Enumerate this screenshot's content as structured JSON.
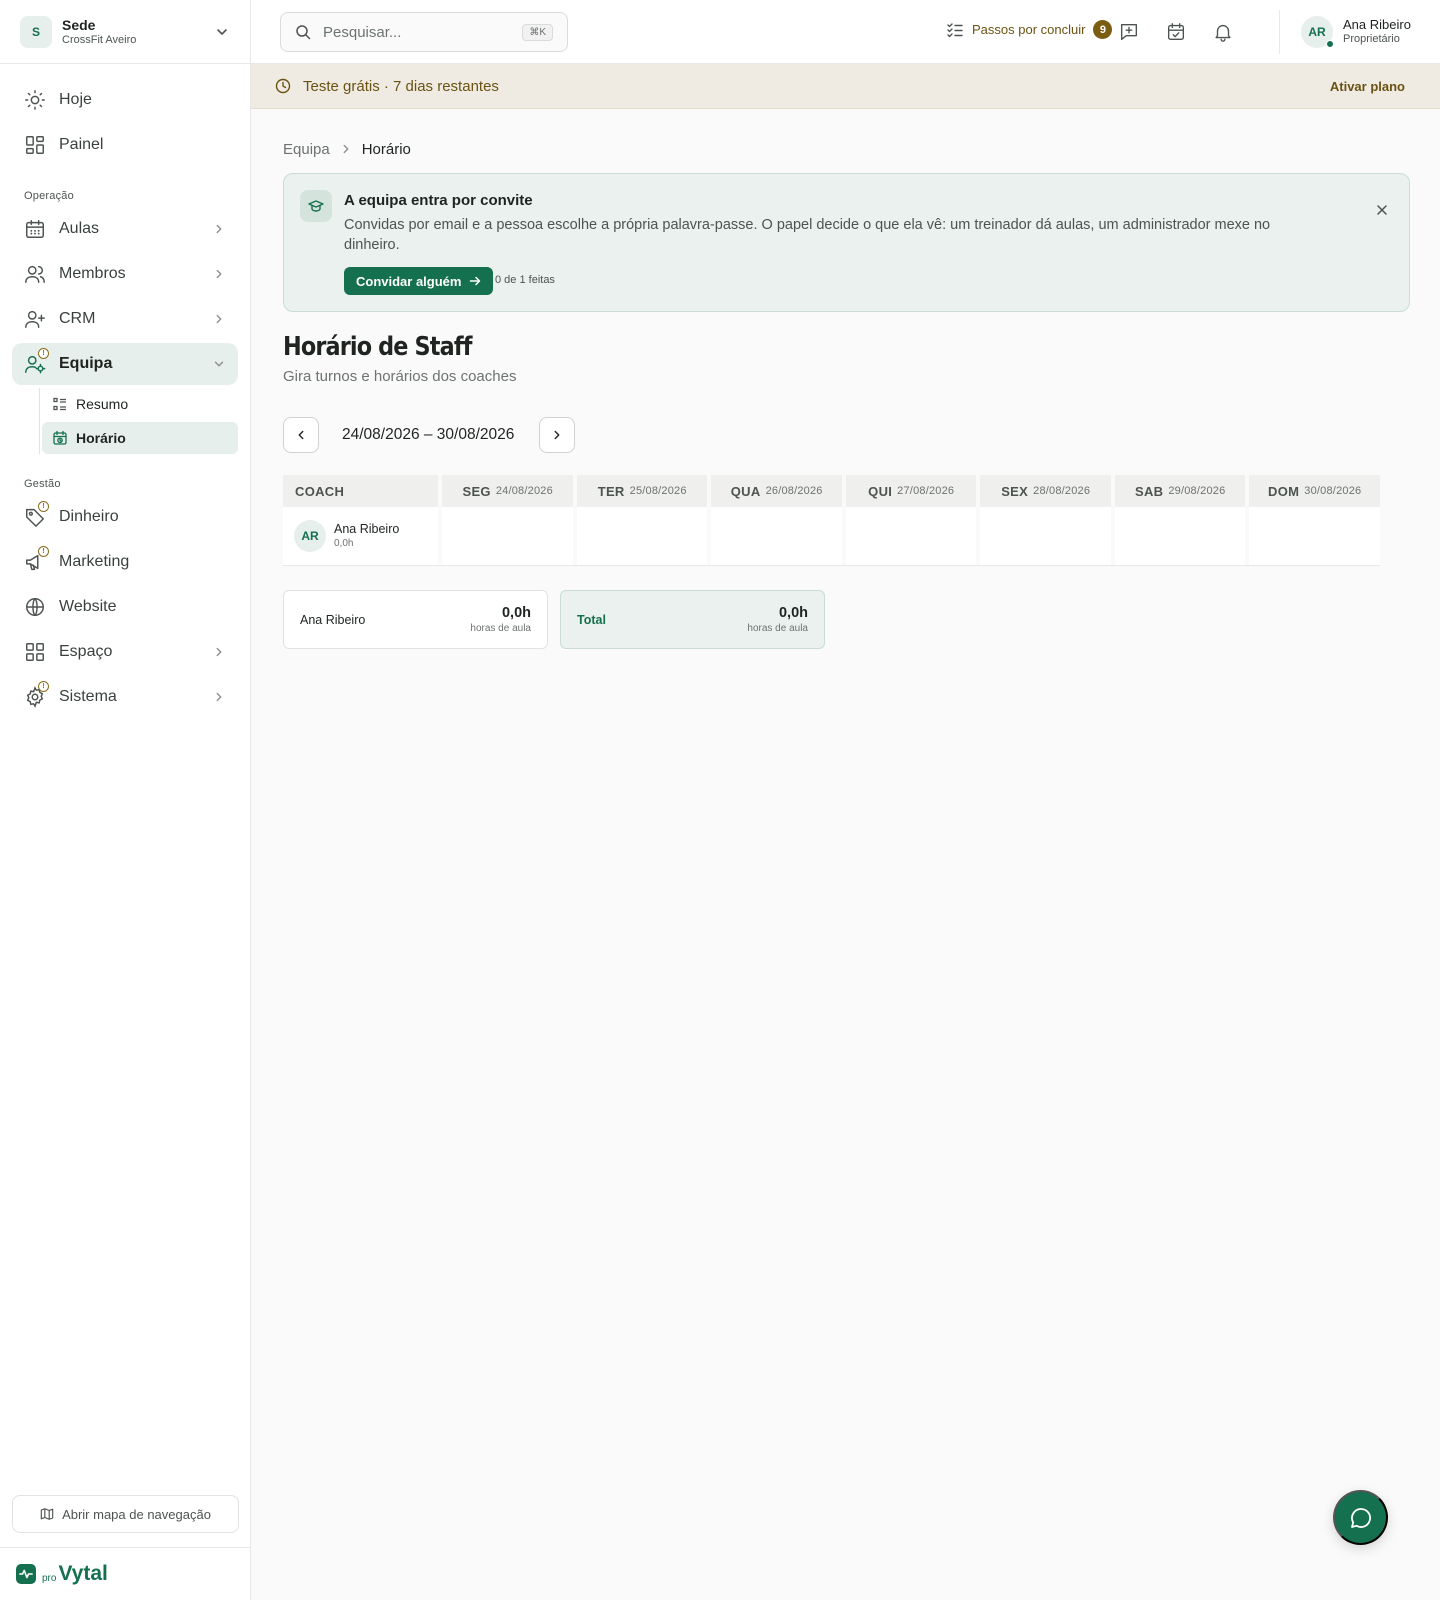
{
  "org": {
    "avatar": "S",
    "name": "Sede",
    "sub": "CrossFit Aveiro"
  },
  "nav": {
    "hoje": "Hoje",
    "painel": "Painel",
    "section_operacao": "Operação",
    "aulas": "Aulas",
    "membros": "Membros",
    "crm": "CRM",
    "equipa": "Equipa",
    "equipa_sub": {
      "resumo": "Resumo",
      "horario": "Horário"
    },
    "section_gestao": "Gestão",
    "dinheiro": "Dinheiro",
    "marketing": "Marketing",
    "website": "Website",
    "espaco": "Espaço",
    "sistema": "Sistema",
    "badge_glyph": "!"
  },
  "sidebar_footer": {
    "map_button": "Abrir mapa de navegação",
    "brand_pro": "pro",
    "brand_name": "Vytal"
  },
  "topbar": {
    "search_placeholder": "Pesquisar...",
    "search_shortcut": "⌘K",
    "steps_label": "Passos por concluir",
    "steps_count": "9",
    "user_initials": "AR",
    "user_name": "Ana Ribeiro",
    "user_role": "Proprietário"
  },
  "trial": {
    "text": "Teste grátis · 7 dias restantes",
    "action": "Ativar plano"
  },
  "breadcrumb": {
    "parent": "Equipa",
    "current": "Horário"
  },
  "info_card": {
    "title": "A equipa entra por convite",
    "body": "Convidas por email e a pessoa escolhe a própria palavra-passe. O papel decide o que ela vê: um treinador dá aulas, um administrador mexe no dinheiro.",
    "cta": "Convidar alguém",
    "progress": "0 de 1 feitas"
  },
  "page": {
    "title": "Horário de Staff",
    "subtitle": "Gira turnos e horários dos coaches"
  },
  "week": {
    "range": "24/08/2026 – 30/08/2026"
  },
  "schedule": {
    "coach_header": "COACH",
    "days": [
      {
        "name": "SEG",
        "date": "24/08/2026"
      },
      {
        "name": "TER",
        "date": "25/08/2026"
      },
      {
        "name": "QUA",
        "date": "26/08/2026"
      },
      {
        "name": "QUI",
        "date": "27/08/2026"
      },
      {
        "name": "SEX",
        "date": "28/08/2026"
      },
      {
        "name": "SAB",
        "date": "29/08/2026"
      },
      {
        "name": "DOM",
        "date": "30/08/2026"
      }
    ],
    "rows": [
      {
        "initials": "AR",
        "name": "Ana Ribeiro",
        "hours": "0,0h"
      }
    ]
  },
  "totals": [
    {
      "name": "Ana Ribeiro",
      "value": "0,0h",
      "unit": "horas de aula"
    },
    {
      "name": "Total",
      "value": "0,0h",
      "unit": "horas de aula"
    }
  ],
  "colors": {
    "accent": "#15704f",
    "accent_soft": "#e6efeb",
    "trial_bg": "#efebe2",
    "trial_text": "#6a5312"
  }
}
